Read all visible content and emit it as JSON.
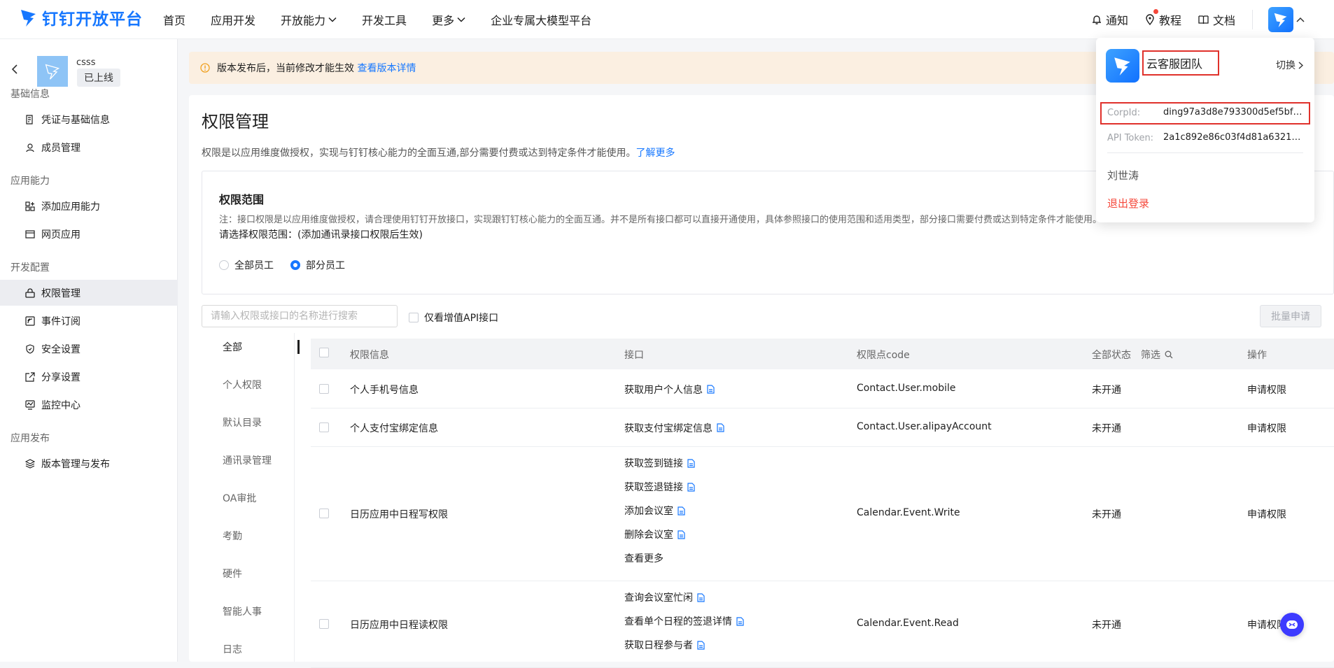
{
  "brand": {
    "name": "钉钉开放平台"
  },
  "nav": {
    "items": [
      {
        "label": "首页",
        "dropdown": false
      },
      {
        "label": "应用开发",
        "dropdown": false
      },
      {
        "label": "开放能力",
        "dropdown": true
      },
      {
        "label": "开发工具",
        "dropdown": false
      },
      {
        "label": "更多",
        "dropdown": true
      },
      {
        "label": "企业专属大模型平台",
        "dropdown": false
      }
    ],
    "right": {
      "notify": "通知",
      "tutorial": "教程",
      "docs": "文档"
    }
  },
  "sidebar": {
    "app_name": "csss",
    "app_status": "已上线",
    "groups": [
      {
        "title": "基础信息",
        "items": [
          {
            "label": "凭证与基础信息",
            "icon": "credential-icon"
          },
          {
            "label": "成员管理",
            "icon": "member-icon"
          }
        ]
      },
      {
        "title": "应用能力",
        "items": [
          {
            "label": "添加应用能力",
            "icon": "add-capability-icon"
          },
          {
            "label": "网页应用",
            "icon": "web-app-icon"
          }
        ]
      },
      {
        "title": "开发配置",
        "items": [
          {
            "label": "权限管理",
            "icon": "permission-icon",
            "active": true
          },
          {
            "label": "事件订阅",
            "icon": "event-subscribe-icon"
          },
          {
            "label": "安全设置",
            "icon": "shield-icon"
          },
          {
            "label": "分享设置",
            "icon": "share-icon"
          },
          {
            "label": "监控中心",
            "icon": "monitor-icon"
          }
        ]
      },
      {
        "title": "应用发布",
        "items": [
          {
            "label": "版本管理与发布",
            "icon": "layers-icon"
          }
        ]
      }
    ]
  },
  "banner": {
    "text": "版本发布后，当前修改才能生效",
    "link": "查看版本详情"
  },
  "page": {
    "title": "权限管理",
    "desc": "权限是以应用维度做授权，实现与钉钉核心能力的全面互通,部分需要付费或达到特定条件才能使用。",
    "desc_link": "了解更多"
  },
  "scope": {
    "title": "权限范围",
    "note": "注：接口权限是以应用维度做授权，请合理使用钉钉开放接口，实现跟钉钉核心能力的全面互通。并不是所有接口都可以直接开通使用，具体参照接口的使用范围和适用类型，部分接口需要付费或达到特定条件才能使用。",
    "choose": "请选择权限范围：(添加通讯录接口权限后生效)",
    "options": [
      "全部员工",
      "部分员工"
    ],
    "selected": 1
  },
  "filter": {
    "search_placeholder": "请输入权限或接口的名称进行搜索",
    "only_paid_label": "仅看增值API接口",
    "batch_label": "批量申请"
  },
  "categories": [
    "全部",
    "个人权限",
    "默认目录",
    "通讯录管理",
    "OA审批",
    "考勤",
    "硬件",
    "智能人事",
    "日志"
  ],
  "table": {
    "headers": {
      "info": "权限信息",
      "api": "接口",
      "code": "权限点code",
      "status": "全部状态",
      "filter": "筛选",
      "action": "操作"
    },
    "rows": [
      {
        "info": "个人手机号信息",
        "apis": [
          "获取用户个人信息"
        ],
        "more": "",
        "code": "Contact.User.mobile",
        "status": "未开通",
        "action": "申请权限"
      },
      {
        "info": "个人支付宝绑定信息",
        "apis": [
          "获取支付宝绑定信息"
        ],
        "more": "",
        "code": "Contact.User.alipayAccount",
        "status": "未开通",
        "action": "申请权限"
      },
      {
        "info": "日历应用中日程写权限",
        "apis": [
          "获取签到链接",
          "获取签退链接",
          "添加会议室",
          "删除会议室"
        ],
        "more": "查看更多",
        "code": "Calendar.Event.Write",
        "status": "未开通",
        "action": "申请权限"
      },
      {
        "info": "日历应用中日程读权限",
        "apis": [
          "查询会议室忙闲",
          "查看单个日程的签退详情",
          "获取日程参与者"
        ],
        "more": "",
        "code": "Calendar.Event.Read",
        "status": "未开通",
        "action": "申请权限"
      }
    ]
  },
  "popup": {
    "org_name": "云客服团队",
    "switch_label": "切换",
    "corp_label": "CorpId:",
    "corp_value": "ding97a3d8e793300d5ef5bf40...",
    "token_label": "API Token:",
    "token_value": "2a1c892e86c03f4d81a632102a...",
    "user": "刘世涛",
    "logout": "退出登录"
  },
  "colors": {
    "accent": "#1677ff",
    "danger": "#f5483b",
    "banner_bg": "#fbefe1",
    "highlight_border": "#e0312b"
  }
}
